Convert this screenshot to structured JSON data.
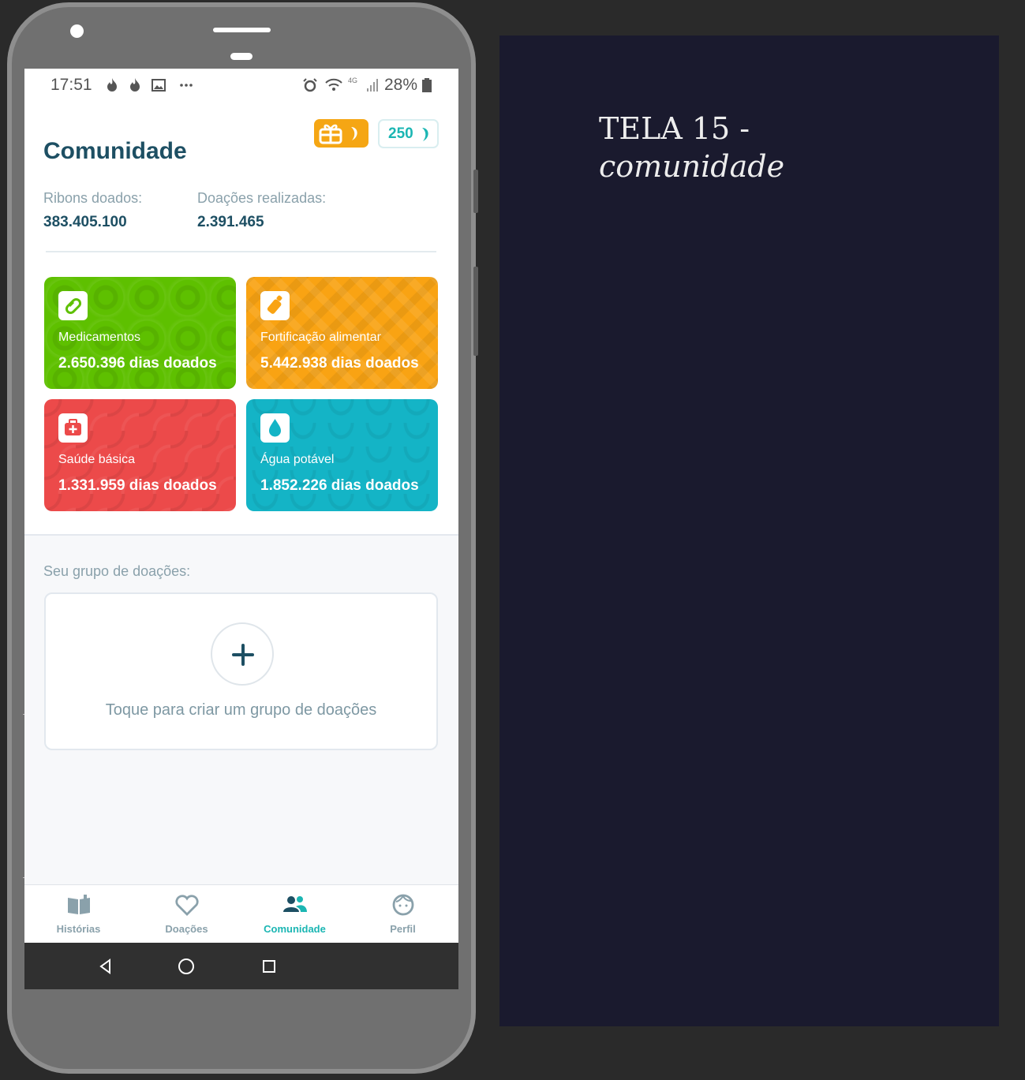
{
  "statusbar": {
    "time": "17:51",
    "battery": "28%",
    "network": "4G",
    "icons": [
      "fire-icon",
      "fire-icon",
      "image-icon",
      "more-icon",
      "alarm-icon",
      "wifi-icon",
      "signal-icon",
      "battery-icon"
    ]
  },
  "header": {
    "title": "Comunidade",
    "points": "250",
    "gift_icon": "gift-icon",
    "ribbon_icon": "ribbon-icon"
  },
  "stats": {
    "ribbons_label": "Ribons doados:",
    "ribbons_value": "383.405.100",
    "donations_label": "Doações realizadas:",
    "donations_value": "2.391.465"
  },
  "causes": [
    {
      "label": "Medicamentos",
      "value": "2.650.396 dias doados",
      "icon": "pill-icon",
      "color": "#5ec000"
    },
    {
      "label": "Fortificação alimentar",
      "value": "5.442.938 dias doados",
      "icon": "baby-bottle-icon",
      "color": "#f9a313"
    },
    {
      "label": "Saúde básica",
      "value": "1.331.959 dias doados",
      "icon": "medical-kit-icon",
      "color": "#ec4a4a"
    },
    {
      "label": "Água potável",
      "value": "1.852.226 dias doados",
      "icon": "water-drop-icon",
      "color": "#14b4c6"
    }
  ],
  "group": {
    "label": "Seu grupo de doações:",
    "cta": "Toque para criar um grupo de doações"
  },
  "tabs": [
    {
      "label": "Histórias",
      "icon": "book-icon",
      "active": false
    },
    {
      "label": "Doações",
      "icon": "heart-icon",
      "active": false
    },
    {
      "label": "Comunidade",
      "icon": "people-icon",
      "active": true
    },
    {
      "label": "Perfil",
      "icon": "face-icon",
      "active": false
    }
  ],
  "panel": {
    "title": "TELA 15 -",
    "subtitle": "comunidade"
  },
  "colors": {
    "accent": "#1bb6b3",
    "title": "#1d4f63",
    "panel_bg": "#1a1a2e"
  }
}
